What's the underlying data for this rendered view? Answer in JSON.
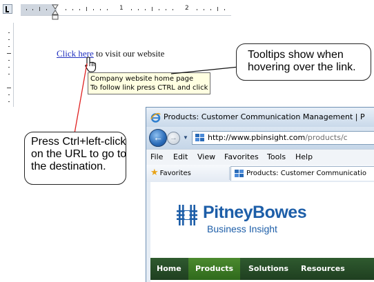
{
  "word": {
    "ruler_numbers": [
      "1",
      "2"
    ],
    "link_text": "Click here",
    "line_rest": " to visit our website",
    "tooltip_line1": "Company website home page",
    "tooltip_line2": "To follow link press CTRL and click"
  },
  "callouts": {
    "tooltips": [
      "Tooltips show when",
      "hovering over the link."
    ],
    "press": [
      "Press Ctrl+left-click",
      "on the URL to go to",
      "the destination."
    ]
  },
  "browser": {
    "title": "Products: Customer Communication Management | P",
    "address_host": "http://www.pbinsight.com",
    "address_path": "/products/c",
    "menu": [
      "File",
      "Edit",
      "View",
      "Favorites",
      "Tools",
      "Help"
    ],
    "favorites_label": "Favorites",
    "tab_title": "Products: Customer Communicatio",
    "logo_name": "PitneyBowes",
    "logo_sub": "Business Insight",
    "site_nav": [
      "Home",
      "Products",
      "Solutions",
      "Resources"
    ]
  },
  "colors": {
    "link": "#1f2fbf",
    "tooltip_bg": "#ffffe1",
    "brand_blue": "#1d5ea8",
    "site_nav_bg": "#2f5a2f",
    "site_nav_active": "#4b8a2e",
    "leader_line": "#e02020"
  },
  "icons": [
    "ruler-tab-selector-icon",
    "indent-marker-icon",
    "hand-cursor-icon",
    "ie-logo-icon",
    "back-arrow-icon",
    "forward-arrow-icon",
    "dropdown-arrow-icon",
    "site-favicon-icon",
    "favorites-star-icon",
    "pitney-bowes-logo-icon"
  ]
}
